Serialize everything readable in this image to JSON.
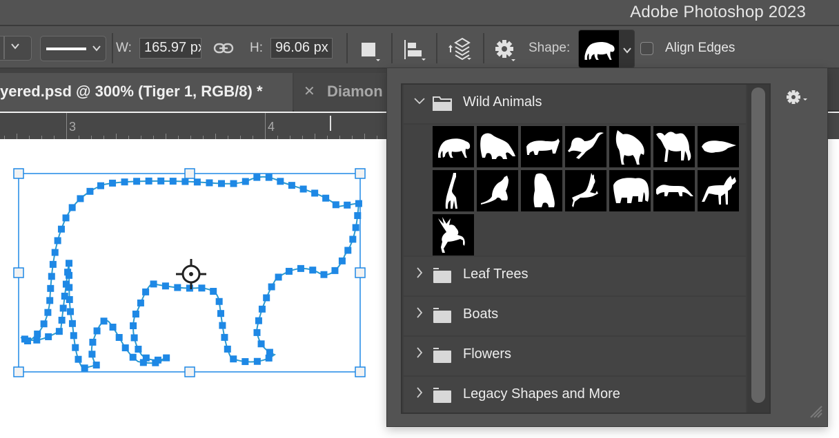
{
  "titlebar": {
    "app_title": "Adobe Photoshop 2023"
  },
  "optbar": {
    "width_label": "W:",
    "width_value": "165.97 px",
    "link_icon": "link-icon",
    "height_label": "H:",
    "height_value": "96.06 px",
    "shape_label": "Shape:",
    "selected_shape": "Tiger",
    "align_edges_label": "Align Edges",
    "align_edges_checked": false
  },
  "tabs": [
    {
      "label": "...yered.psd @ 300% (Tiger 1, RGB/8) *",
      "visible_text": "yered.psd @ 300% (Tiger 1, RGB/8) *",
      "active": true
    },
    {
      "label": "Diamon",
      "active": false
    }
  ],
  "ruler": {
    "labels": [
      "3",
      "4"
    ]
  },
  "shape_picker": {
    "groups": [
      {
        "name": "Wild Animals",
        "expanded": true,
        "shapes": [
          "Tiger",
          "Lion",
          "Rhinoceros",
          "Ostrich",
          "Wolf",
          "Camel",
          "Mole",
          "Giraffe",
          "Kangaroo",
          "Gorilla",
          "Gazelle",
          "Elephant",
          "Cheetah",
          "Moose",
          "Deer"
        ]
      },
      {
        "name": "Leaf Trees",
        "expanded": false
      },
      {
        "name": "Boats",
        "expanded": false
      },
      {
        "name": "Flowers",
        "expanded": false
      },
      {
        "name": "Legacy Shapes and More",
        "expanded": false
      }
    ]
  },
  "colors": {
    "path_blue": "#1e88e5",
    "panel_bg": "#535353",
    "list_bg": "#3e3e3e"
  }
}
